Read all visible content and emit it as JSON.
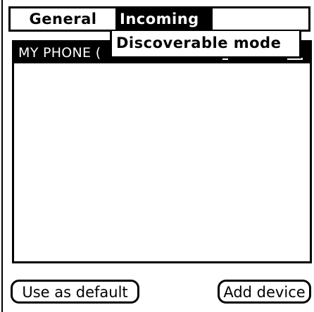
{
  "menubar": {
    "items": [
      {
        "label": "General",
        "selected": false
      },
      {
        "label": "Incoming",
        "selected": true
      }
    ]
  },
  "dropdown": {
    "items": [
      {
        "label": "Discoverable mode"
      }
    ]
  },
  "device_list": {
    "header": "MY PHONE (",
    "rows": []
  },
  "buttons": {
    "use_default": "Use as default",
    "add_device": "Add device"
  },
  "colors": {
    "foreground": "#000000",
    "background": "#ffffff"
  }
}
